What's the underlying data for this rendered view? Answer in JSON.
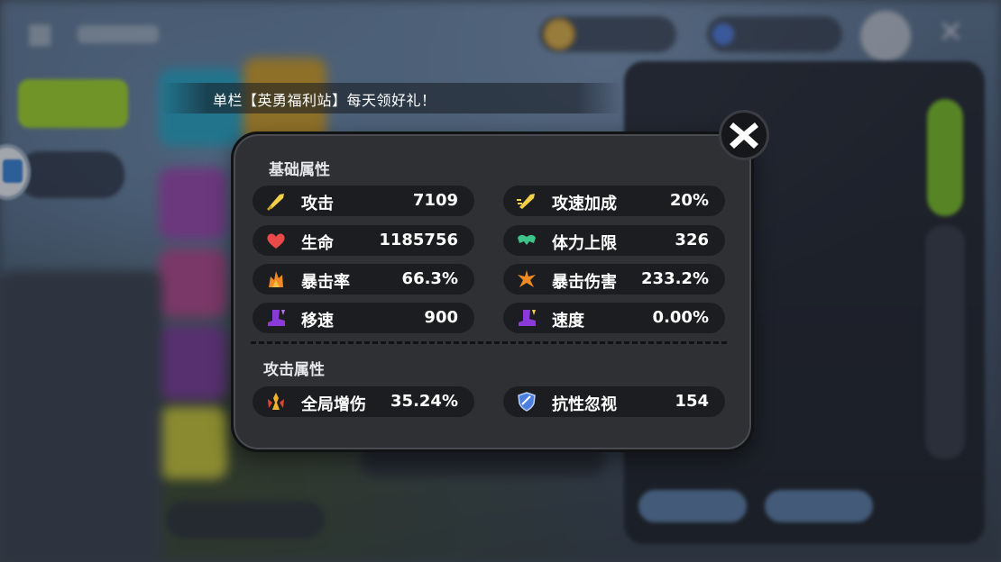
{
  "marquee": {
    "text": "单栏【英勇福利站】每天领好礼！"
  },
  "modal": {
    "base_title": "基础属性",
    "attack_title": "攻击属性",
    "base_stats": [
      {
        "label": "攻击",
        "value": "7109",
        "icon": "sword-icon"
      },
      {
        "label": "攻速加成",
        "value": "20%",
        "icon": "attack-speed-icon"
      },
      {
        "label": "生命",
        "value": "1185756",
        "icon": "heart-icon"
      },
      {
        "label": "体力上限",
        "value": "326",
        "icon": "stamina-icon"
      },
      {
        "label": "暴击率",
        "value": "66.3%",
        "icon": "crit-rate-icon"
      },
      {
        "label": "暴击伤害",
        "value": "233.2%",
        "icon": "crit-damage-icon"
      },
      {
        "label": "移速",
        "value": "900",
        "icon": "boot-icon"
      },
      {
        "label": "速度",
        "value": "0.00%",
        "icon": "boot-icon"
      }
    ],
    "attack_stats": [
      {
        "label": "全局增伤",
        "value": "35.24%",
        "icon": "damage-boost-icon"
      },
      {
        "label": "抗性忽视",
        "value": "154",
        "icon": "shield-icon"
      }
    ]
  },
  "colors": {
    "modal_bg": "#2f3034",
    "stat_pill": "#1c1d20",
    "sword": "#f2d04a",
    "heart": "#e84a4a",
    "stamina": "#3dc28a",
    "crit": "#f08a24",
    "boot": "#8a3ad8",
    "shield": "#4a7fe0"
  }
}
